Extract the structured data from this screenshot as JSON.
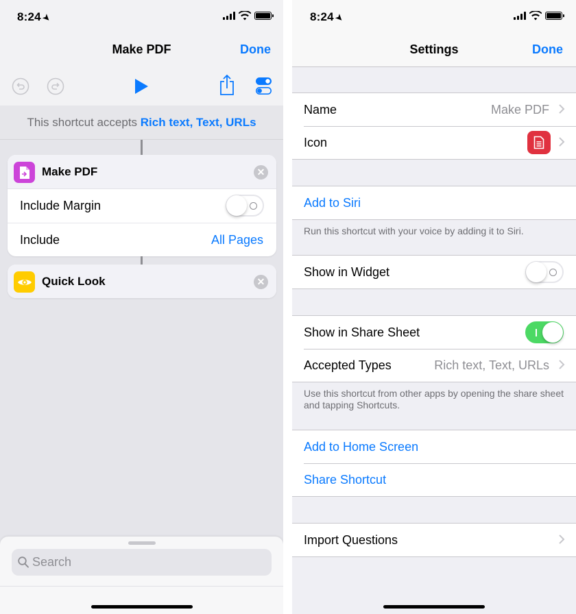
{
  "left": {
    "status": {
      "time": "8:24"
    },
    "nav": {
      "title": "Make PDF",
      "done": "Done"
    },
    "accepts": {
      "prefix": "This shortcut accepts ",
      "types": "Rich text, Text, URLs"
    },
    "actions": [
      {
        "title": "Make PDF",
        "icon": "pdf-icon",
        "color": "#cc44d9",
        "rows": [
          {
            "label": "Include Margin",
            "toggle": false
          },
          {
            "label": "Include",
            "value": "All Pages"
          }
        ]
      },
      {
        "title": "Quick Look",
        "icon": "eye-icon",
        "color": "#ffcc00"
      }
    ],
    "search": {
      "placeholder": "Search"
    }
  },
  "right": {
    "status": {
      "time": "8:24"
    },
    "nav": {
      "title": "Settings",
      "done": "Done"
    },
    "name": {
      "label": "Name",
      "value": "Make PDF"
    },
    "icon": {
      "label": "Icon",
      "color": "#e0313f"
    },
    "siri": {
      "label": "Add to Siri",
      "note": "Run this shortcut with your voice by adding it to Siri."
    },
    "widget": {
      "label": "Show in Widget",
      "on": false
    },
    "share_sheet": {
      "label": "Show in Share Sheet",
      "on": true
    },
    "accepted_types": {
      "label": "Accepted Types",
      "value": "Rich text, Text, URLs",
      "note": "Use this shortcut from other apps by opening the share sheet and tapping Shortcuts."
    },
    "home_screen": {
      "label": "Add to Home Screen"
    },
    "share_shortcut": {
      "label": "Share Shortcut"
    },
    "import_questions": {
      "label": "Import Questions"
    }
  },
  "colors": {
    "accent": "#0a7aff",
    "toggle_on": "#4cd964"
  }
}
